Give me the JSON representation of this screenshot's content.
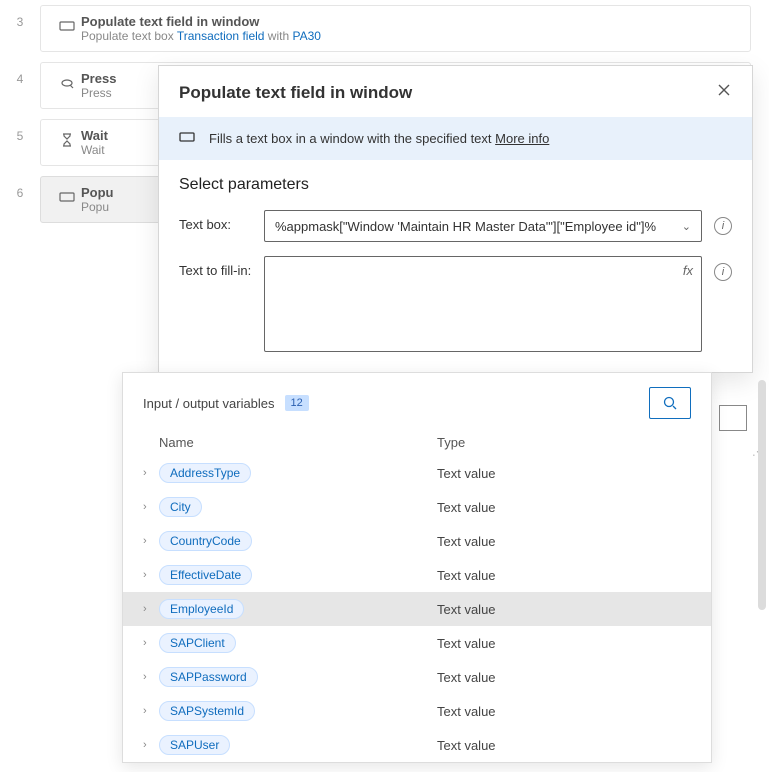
{
  "actions": [
    {
      "num": "3",
      "title": "Populate text field in window",
      "sub_prefix": "Populate text box ",
      "sub_link1": "Transaction field",
      "sub_mid": " with ",
      "sub_link2": "PA30"
    },
    {
      "num": "4",
      "title": "Press",
      "sub": "Press"
    },
    {
      "num": "5",
      "title": "Wait",
      "sub": "Wait"
    },
    {
      "num": "6",
      "title": "Popu",
      "sub": "Popu",
      "selected": true
    }
  ],
  "dialog": {
    "title": "Populate text field in window",
    "banner_text": "Fills a text box in a window with the specified text ",
    "more_info": "More info",
    "section": "Select parameters",
    "label_textbox": "Text box:",
    "textbox_value": "%appmask[\"Window 'Maintain HR Master Data'\"][\"Employee id\"]%",
    "label_fillin": "Text to fill-in:",
    "fx": "fx"
  },
  "variables": {
    "title": "Input / output variables",
    "count": "12",
    "col_name": "Name",
    "col_type": "Type",
    "rows": [
      {
        "name": "AddressType",
        "type": "Text value"
      },
      {
        "name": "City",
        "type": "Text value"
      },
      {
        "name": "CountryCode",
        "type": "Text value"
      },
      {
        "name": "EffectiveDate",
        "type": "Text value"
      },
      {
        "name": "EmployeeId",
        "type": "Text value",
        "hover": true
      },
      {
        "name": "SAPClient",
        "type": "Text value"
      },
      {
        "name": "SAPPassword",
        "type": "Text value"
      },
      {
        "name": "SAPSystemId",
        "type": "Text value"
      },
      {
        "name": "SAPUser",
        "type": "Text value"
      }
    ]
  }
}
